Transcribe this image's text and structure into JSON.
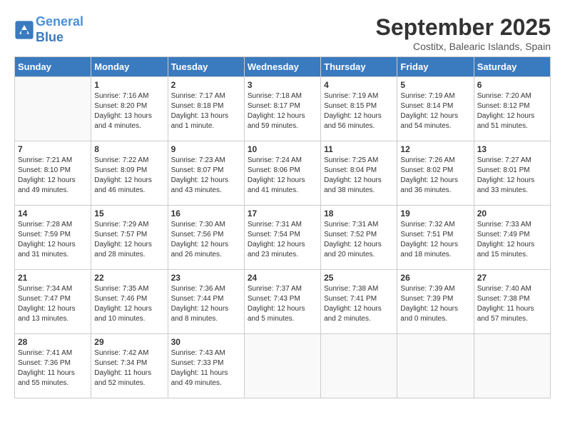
{
  "header": {
    "logo_line1": "General",
    "logo_line2": "Blue",
    "month": "September 2025",
    "location": "Costitx, Balearic Islands, Spain"
  },
  "days_of_week": [
    "Sunday",
    "Monday",
    "Tuesday",
    "Wednesday",
    "Thursday",
    "Friday",
    "Saturday"
  ],
  "weeks": [
    [
      {
        "day": "",
        "info": ""
      },
      {
        "day": "1",
        "info": "Sunrise: 7:16 AM\nSunset: 8:20 PM\nDaylight: 13 hours\nand 4 minutes."
      },
      {
        "day": "2",
        "info": "Sunrise: 7:17 AM\nSunset: 8:18 PM\nDaylight: 13 hours\nand 1 minute."
      },
      {
        "day": "3",
        "info": "Sunrise: 7:18 AM\nSunset: 8:17 PM\nDaylight: 12 hours\nand 59 minutes."
      },
      {
        "day": "4",
        "info": "Sunrise: 7:19 AM\nSunset: 8:15 PM\nDaylight: 12 hours\nand 56 minutes."
      },
      {
        "day": "5",
        "info": "Sunrise: 7:19 AM\nSunset: 8:14 PM\nDaylight: 12 hours\nand 54 minutes."
      },
      {
        "day": "6",
        "info": "Sunrise: 7:20 AM\nSunset: 8:12 PM\nDaylight: 12 hours\nand 51 minutes."
      }
    ],
    [
      {
        "day": "7",
        "info": "Sunrise: 7:21 AM\nSunset: 8:10 PM\nDaylight: 12 hours\nand 49 minutes."
      },
      {
        "day": "8",
        "info": "Sunrise: 7:22 AM\nSunset: 8:09 PM\nDaylight: 12 hours\nand 46 minutes."
      },
      {
        "day": "9",
        "info": "Sunrise: 7:23 AM\nSunset: 8:07 PM\nDaylight: 12 hours\nand 43 minutes."
      },
      {
        "day": "10",
        "info": "Sunrise: 7:24 AM\nSunset: 8:06 PM\nDaylight: 12 hours\nand 41 minutes."
      },
      {
        "day": "11",
        "info": "Sunrise: 7:25 AM\nSunset: 8:04 PM\nDaylight: 12 hours\nand 38 minutes."
      },
      {
        "day": "12",
        "info": "Sunrise: 7:26 AM\nSunset: 8:02 PM\nDaylight: 12 hours\nand 36 minutes."
      },
      {
        "day": "13",
        "info": "Sunrise: 7:27 AM\nSunset: 8:01 PM\nDaylight: 12 hours\nand 33 minutes."
      }
    ],
    [
      {
        "day": "14",
        "info": "Sunrise: 7:28 AM\nSunset: 7:59 PM\nDaylight: 12 hours\nand 31 minutes."
      },
      {
        "day": "15",
        "info": "Sunrise: 7:29 AM\nSunset: 7:57 PM\nDaylight: 12 hours\nand 28 minutes."
      },
      {
        "day": "16",
        "info": "Sunrise: 7:30 AM\nSunset: 7:56 PM\nDaylight: 12 hours\nand 26 minutes."
      },
      {
        "day": "17",
        "info": "Sunrise: 7:31 AM\nSunset: 7:54 PM\nDaylight: 12 hours\nand 23 minutes."
      },
      {
        "day": "18",
        "info": "Sunrise: 7:31 AM\nSunset: 7:52 PM\nDaylight: 12 hours\nand 20 minutes."
      },
      {
        "day": "19",
        "info": "Sunrise: 7:32 AM\nSunset: 7:51 PM\nDaylight: 12 hours\nand 18 minutes."
      },
      {
        "day": "20",
        "info": "Sunrise: 7:33 AM\nSunset: 7:49 PM\nDaylight: 12 hours\nand 15 minutes."
      }
    ],
    [
      {
        "day": "21",
        "info": "Sunrise: 7:34 AM\nSunset: 7:47 PM\nDaylight: 12 hours\nand 13 minutes."
      },
      {
        "day": "22",
        "info": "Sunrise: 7:35 AM\nSunset: 7:46 PM\nDaylight: 12 hours\nand 10 minutes."
      },
      {
        "day": "23",
        "info": "Sunrise: 7:36 AM\nSunset: 7:44 PM\nDaylight: 12 hours\nand 8 minutes."
      },
      {
        "day": "24",
        "info": "Sunrise: 7:37 AM\nSunset: 7:43 PM\nDaylight: 12 hours\nand 5 minutes."
      },
      {
        "day": "25",
        "info": "Sunrise: 7:38 AM\nSunset: 7:41 PM\nDaylight: 12 hours\nand 2 minutes."
      },
      {
        "day": "26",
        "info": "Sunrise: 7:39 AM\nSunset: 7:39 PM\nDaylight: 12 hours\nand 0 minutes."
      },
      {
        "day": "27",
        "info": "Sunrise: 7:40 AM\nSunset: 7:38 PM\nDaylight: 11 hours\nand 57 minutes."
      }
    ],
    [
      {
        "day": "28",
        "info": "Sunrise: 7:41 AM\nSunset: 7:36 PM\nDaylight: 11 hours\nand 55 minutes."
      },
      {
        "day": "29",
        "info": "Sunrise: 7:42 AM\nSunset: 7:34 PM\nDaylight: 11 hours\nand 52 minutes."
      },
      {
        "day": "30",
        "info": "Sunrise: 7:43 AM\nSunset: 7:33 PM\nDaylight: 11 hours\nand 49 minutes."
      },
      {
        "day": "",
        "info": ""
      },
      {
        "day": "",
        "info": ""
      },
      {
        "day": "",
        "info": ""
      },
      {
        "day": "",
        "info": ""
      }
    ]
  ]
}
